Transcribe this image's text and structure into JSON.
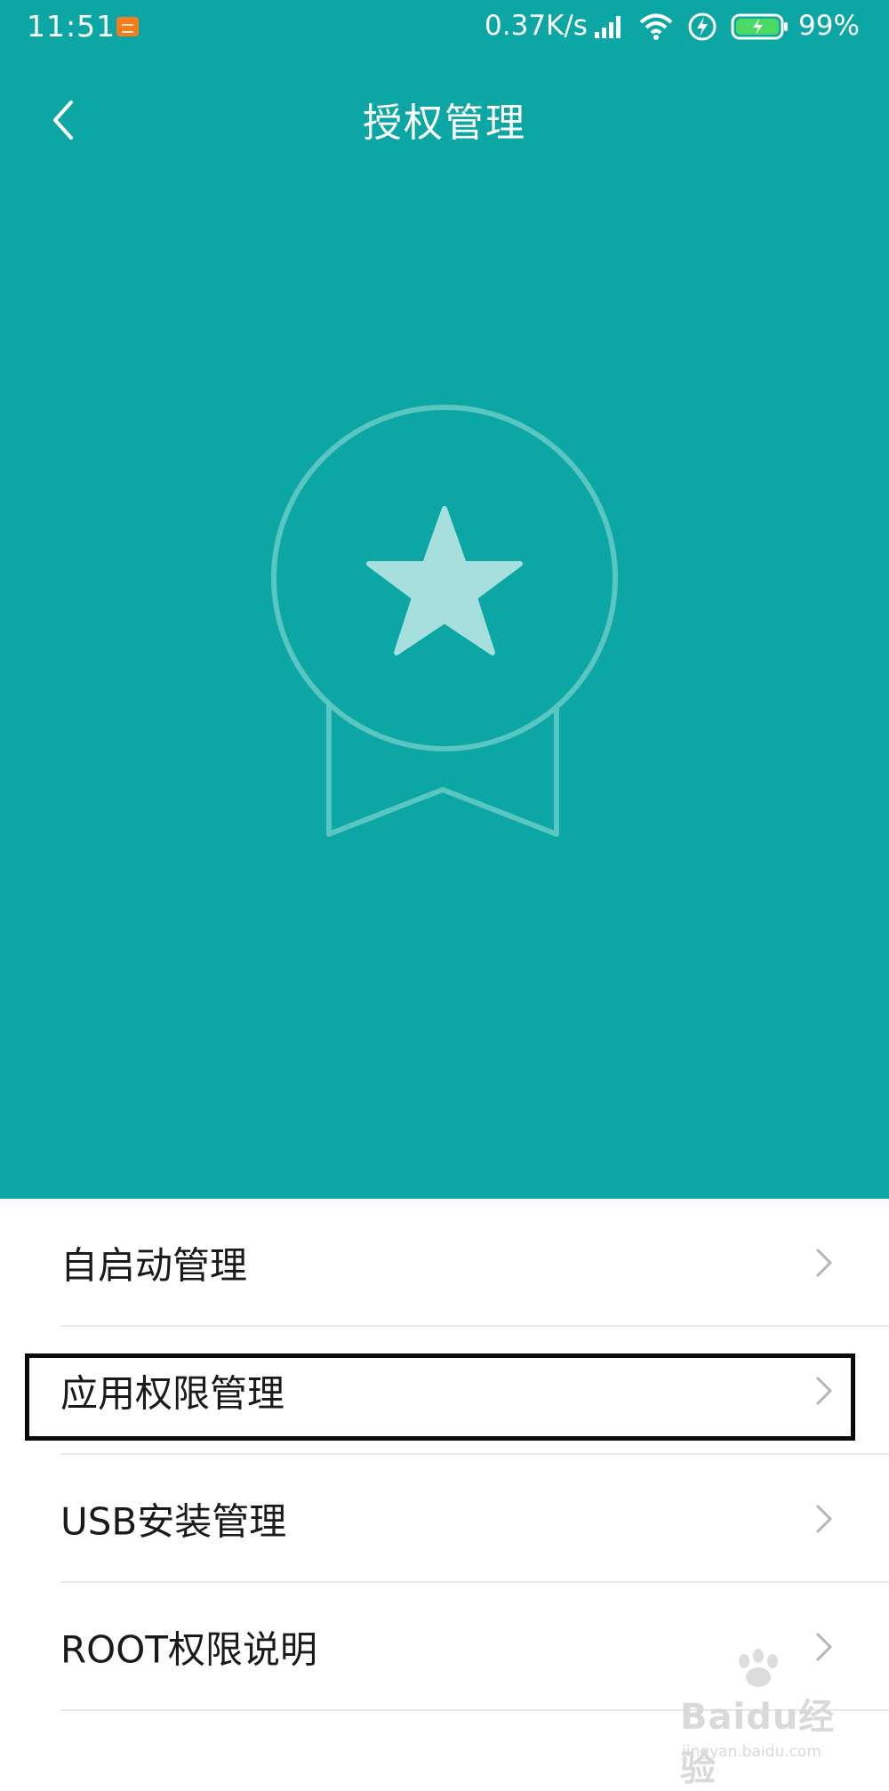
{
  "status_bar": {
    "time": "11:51",
    "net_speed": "0.37K/s",
    "battery_percent": "99%",
    "icons": [
      "notification-icon",
      "signal-icon",
      "wifi-icon",
      "charging-bolt-icon",
      "battery-icon"
    ]
  },
  "header": {
    "title": "授权管理",
    "back_icon": "chevron-left-icon"
  },
  "hero": {
    "illustration": "medal-star-icon"
  },
  "menu": {
    "items": [
      {
        "label": "自启动管理"
      },
      {
        "label": "应用权限管理",
        "highlighted": true
      },
      {
        "label": "USB安装管理"
      },
      {
        "label": "ROOT权限说明"
      }
    ]
  },
  "watermark": {
    "logo": "Baidu经验",
    "url": "jingyan.baidu.com"
  },
  "colors": {
    "accent": "#0ca6a4",
    "highlight_border": "#0a0a0a"
  }
}
